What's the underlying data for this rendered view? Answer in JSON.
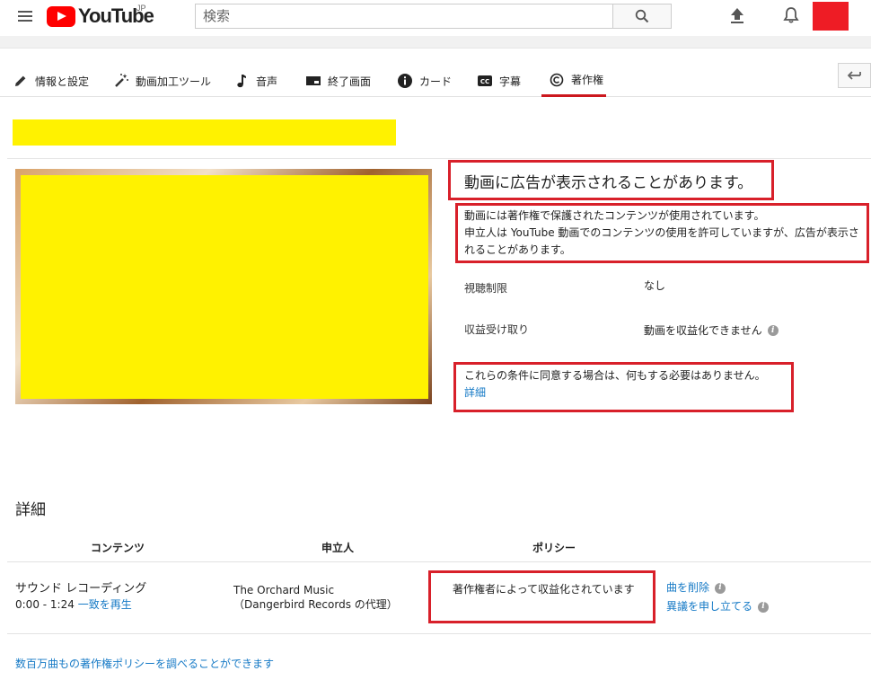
{
  "header": {
    "logo_text": "YouTube",
    "logo_region": "JP",
    "search_placeholder": "検索",
    "avatar_color": "#ee1c25"
  },
  "tabs": [
    {
      "label": "情報と設定",
      "icon": "pencil-icon"
    },
    {
      "label": "動画加工ツール",
      "icon": "magic-wand-icon"
    },
    {
      "label": "音声",
      "icon": "music-note-icon"
    },
    {
      "label": "終了画面",
      "icon": "end-screen-icon"
    },
    {
      "label": "カード",
      "icon": "info-card-icon"
    },
    {
      "label": "字幕",
      "icon": "cc-icon"
    },
    {
      "label": "著作権",
      "icon": "copyright-icon",
      "active": true
    }
  ],
  "claim": {
    "headline": "動画に広告が表示されることがあります。",
    "desc_line1": "動画には著作権で保護されたコンテンツが使用されています。",
    "desc_line2": "申立人は YouTube 動画でのコンテンツの使用を許可していますが、広告が表示されることがあります。",
    "restriction_label": "視聴制限",
    "restriction_value": "なし",
    "monetization_label": "収益受け取り",
    "monetization_value": "動画を収益化できません",
    "agree_text": "これらの条件に同意する場合は、何もする必要はありません。",
    "learn_more": "詳細"
  },
  "details": {
    "heading": "詳細",
    "columns": [
      "コンテンツ",
      "申立人",
      "ポリシー"
    ],
    "row": {
      "content_type": "サウンド レコーディング",
      "time_range": "0:00 - 1:24",
      "play_match": "一致を再生",
      "claimant_name": "The Orchard Music",
      "claimant_sub": "（Dangerbird Records の代理）",
      "policy": "著作権者によって収益化されています",
      "action_remove": "曲を削除",
      "action_dispute": "異議を申し立てる"
    },
    "footer_link": "数百万曲もの著作権ポリシーを調べることができます"
  },
  "colors": {
    "accent_red": "#cc181e",
    "highlight_box": "#d8202a",
    "link_blue": "#167ac6",
    "redaction_yellow": "#fff200"
  }
}
